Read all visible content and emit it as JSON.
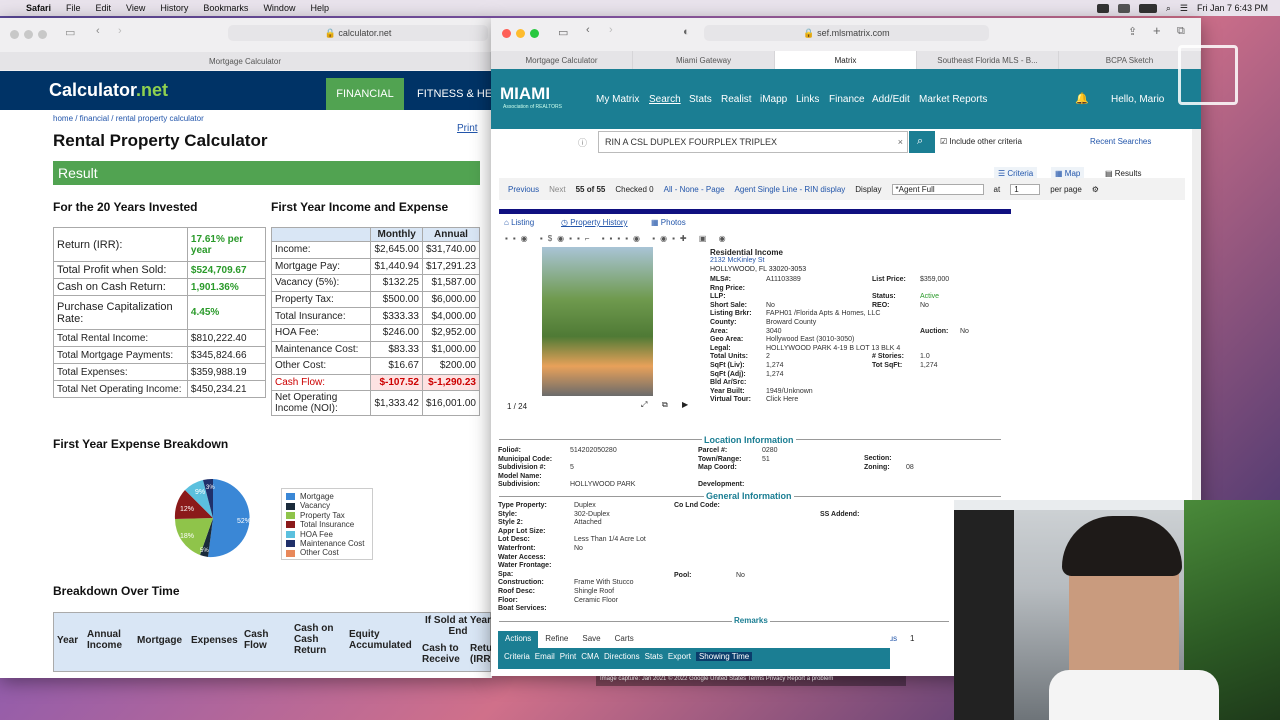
{
  "menubar": {
    "app": "Safari",
    "items": [
      "File",
      "Edit",
      "View",
      "History",
      "Bookmarks",
      "Window",
      "Help"
    ],
    "clock": "Fri Jan 7  6:43 PM"
  },
  "calc_window": {
    "url": "calculator.net",
    "tab": "Mortgage Calculator",
    "logo_main": "Calculator",
    "logo_suffix": ".net",
    "nav": [
      "FINANCIAL",
      "FITNESS & HE"
    ],
    "breadcrumb": "home / financial / rental property calculator",
    "print": "Print",
    "title": "Rental Property Calculator",
    "result": "Result",
    "invested_heading": "For the 20 Years Invested",
    "invested_rows": [
      {
        "label": "Return (IRR):",
        "value": "17.61% per year",
        "green": true
      },
      {
        "label": "Total Profit when Sold:",
        "value": "$524,709.67",
        "green": true
      },
      {
        "label": "Cash on Cash Return:",
        "value": "1,901.36%",
        "green": true
      },
      {
        "label": "Purchase Capitalization Rate:",
        "value": "4.45%",
        "green": true
      },
      {
        "label": "Total Rental Income:",
        "value": "$810,222.40",
        "green": false
      },
      {
        "label": "Total Mortgage Payments:",
        "value": "$345,824.66",
        "green": false
      },
      {
        "label": "Total Expenses:",
        "value": "$359,988.19",
        "green": false
      },
      {
        "label": "Total Net Operating Income:",
        "value": "$450,234.21",
        "green": false
      }
    ],
    "first_year_heading": "First Year Income and Expense",
    "first_year_cols": [
      "",
      "Monthly",
      "Annual"
    ],
    "first_year_rows": [
      [
        "Income:",
        "$2,645.00",
        "$31,740.00"
      ],
      [
        "Mortgage Pay:",
        "$1,440.94",
        "$17,291.23"
      ],
      [
        "Vacancy (5%):",
        "$132.25",
        "$1,587.00"
      ],
      [
        "Property Tax:",
        "$500.00",
        "$6,000.00"
      ],
      [
        "Total Insurance:",
        "$333.33",
        "$4,000.00"
      ],
      [
        "HOA Fee:",
        "$246.00",
        "$2,952.00"
      ],
      [
        "Maintenance Cost:",
        "$83.33",
        "$1,000.00"
      ],
      [
        "Other Cost:",
        "$16.67",
        "$200.00"
      ],
      [
        "Cash Flow:",
        "$-107.52",
        "$-1,290.23"
      ],
      [
        "Net Operating Income (NOI):",
        "$1,333.42",
        "$16,001.00"
      ]
    ],
    "expense_heading": "First Year Expense Breakdown",
    "pie_labels": {
      "mortgage": "52%",
      "insurance": "12%",
      "property_tax": "18%",
      "hoa": "9%",
      "other": "3%",
      "vacancy": "5%"
    },
    "legend": [
      {
        "label": "Mortgage",
        "color": "#3a87d6"
      },
      {
        "label": "Vacancy",
        "color": "#1a2a3a"
      },
      {
        "label": "Property Tax",
        "color": "#8fc44a"
      },
      {
        "label": "Total Insurance",
        "color": "#8b1a1a"
      },
      {
        "label": "HOA Fee",
        "color": "#5bc0de"
      },
      {
        "label": "Maintenance Cost",
        "color": "#20306a"
      },
      {
        "label": "Other Cost",
        "color": "#e8885a"
      }
    ],
    "over_time_heading": "Breakdown Over Time",
    "over_time_cols": [
      "Year",
      "Annual Income",
      "Mortgage",
      "Expenses",
      "Cash Flow",
      "Cash on Cash Return",
      "Equity Accumulated",
      "If Sold at Year End",
      "Cash to Receive",
      "Retu (IRR"
    ]
  },
  "matrix_window": {
    "url": "sef.mlsmatrix.com",
    "tabs": [
      "Mortgage Calculator",
      "Miami Gateway",
      "Matrix",
      "Southeast Florida MLS - B...",
      "BCPA Sketch"
    ],
    "logo": "MIAMI",
    "logo_sub": "Association of REALTORS",
    "nav": [
      "My Matrix",
      "Search",
      "Stats",
      "Realist",
      "iMapp",
      "Links",
      "Finance",
      "Add/Edit",
      "Market Reports"
    ],
    "greeting": "Hello, Mario",
    "search_text": "RIN A CSL DUPLEX FOURPLEX TRIPLEX",
    "include_other": "Include other criteria",
    "recent_searches": "Recent Searches",
    "view_tabs": [
      "Criteria",
      "Map",
      "Results"
    ],
    "pager": {
      "previous": "Previous",
      "next": "Next",
      "position": "55 of 55",
      "checked": "Checked 0",
      "all_none_page": "All - None - Page",
      "display_links": "Agent Single Line - RIN display",
      "display_label": "Display",
      "display_value": "*Agent Full",
      "at": "at",
      "per_page_value": "1",
      "per_page": "per page"
    },
    "listing_tabs": [
      "Listing",
      "Property History",
      "Photos"
    ],
    "photo_counter": "1 / 24",
    "listing": {
      "type": "Residential Income",
      "address": "2132 McKinley St",
      "city": "HOLLYWOOD, FL 33020-3053",
      "left": [
        [
          "MLS#:",
          "A11103389"
        ],
        [
          "Rng Price:",
          ""
        ],
        [
          "LLP:",
          ""
        ],
        [
          "Short Sale:",
          "No"
        ],
        [
          "Listing Brkr:",
          "FAPH01 /Florida Apts & Homes, LLC"
        ],
        [
          "County:",
          "Broward County"
        ],
        [
          "Area:",
          "3040"
        ],
        [
          "Geo Area:",
          "Hollywood East (3010-3050)"
        ],
        [
          "Legal:",
          "HOLLYWOOD PARK 4-19 B LOT 13 BLK 4"
        ],
        [
          "Total Units:",
          "2"
        ],
        [
          "SqFt (Liv):",
          "1,274"
        ],
        [
          "SqFt (Adj):",
          "1,274"
        ],
        [
          "Bld Ar/Src:",
          ""
        ],
        [
          "Year Built:",
          "1949/Unknown"
        ],
        [
          "Virtual Tour:",
          "Click Here"
        ]
      ],
      "right": [
        [
          "List Price:",
          "$359,000"
        ],
        [
          "Status:",
          "Active"
        ],
        [
          "REO:",
          "No"
        ],
        [
          "Auction:",
          "No"
        ],
        [
          "# Stories:",
          "1.0"
        ],
        [
          "Tot SqFt:",
          "1,274"
        ]
      ]
    },
    "location_heading": "Location Information",
    "location": [
      [
        "Folio#:",
        "514202050280"
      ],
      [
        "Municipal Code:",
        ""
      ],
      [
        "Subdivision #:",
        "5"
      ],
      [
        "Model Name:",
        ""
      ],
      [
        "Subdivision:",
        "HOLLYWOOD PARK"
      ]
    ],
    "location_mid": [
      [
        "Parcel #:",
        "0280"
      ],
      [
        "Town/Range:",
        "51"
      ],
      [
        "Map Coord:",
        ""
      ],
      [
        "Development:",
        ""
      ]
    ],
    "location_right": [
      [
        "Section:",
        ""
      ],
      [
        "Zoning:",
        "08"
      ]
    ],
    "general_heading": "General Information",
    "general": [
      [
        "Type Property:",
        "Duplex"
      ],
      [
        "Style:",
        "302-Duplex"
      ],
      [
        "Style 2:",
        "Attached"
      ],
      [
        "Appr Lot Size:",
        ""
      ],
      [
        "Lot Desc:",
        "Less Than 1/4 Acre Lot"
      ],
      [
        "Waterfront:",
        "No"
      ],
      [
        "Water Access:",
        ""
      ],
      [
        "Water Frontage:",
        ""
      ],
      [
        "Spa:",
        ""
      ],
      [
        "Construction:",
        "Frame With Stucco"
      ],
      [
        "Roof Desc:",
        "Shingle Roof"
      ],
      [
        "Floor:",
        "Ceramic Floor"
      ],
      [
        "Boat Services:",
        ""
      ]
    ],
    "general_mid": [
      [
        "Co Lnd Code:",
        ""
      ],
      [
        "Pool:",
        "No"
      ]
    ],
    "general_right": [
      [
        "SS Addend:",
        ""
      ]
    ],
    "remarks": "Remarks",
    "action_tabs": [
      "Actions",
      "Refine",
      "Save",
      "Carts"
    ],
    "action_buttons": [
      "Criteria",
      "Email",
      "Print",
      "CMA",
      "Directions",
      "Stats",
      "Export",
      "Showing Time"
    ],
    "footer_prev": "Previous",
    "footer_page": "1",
    "map_footer": "Image capture: Jan 2021  © 2022 Google  United States  Terms  Privacy  Report a problem"
  }
}
